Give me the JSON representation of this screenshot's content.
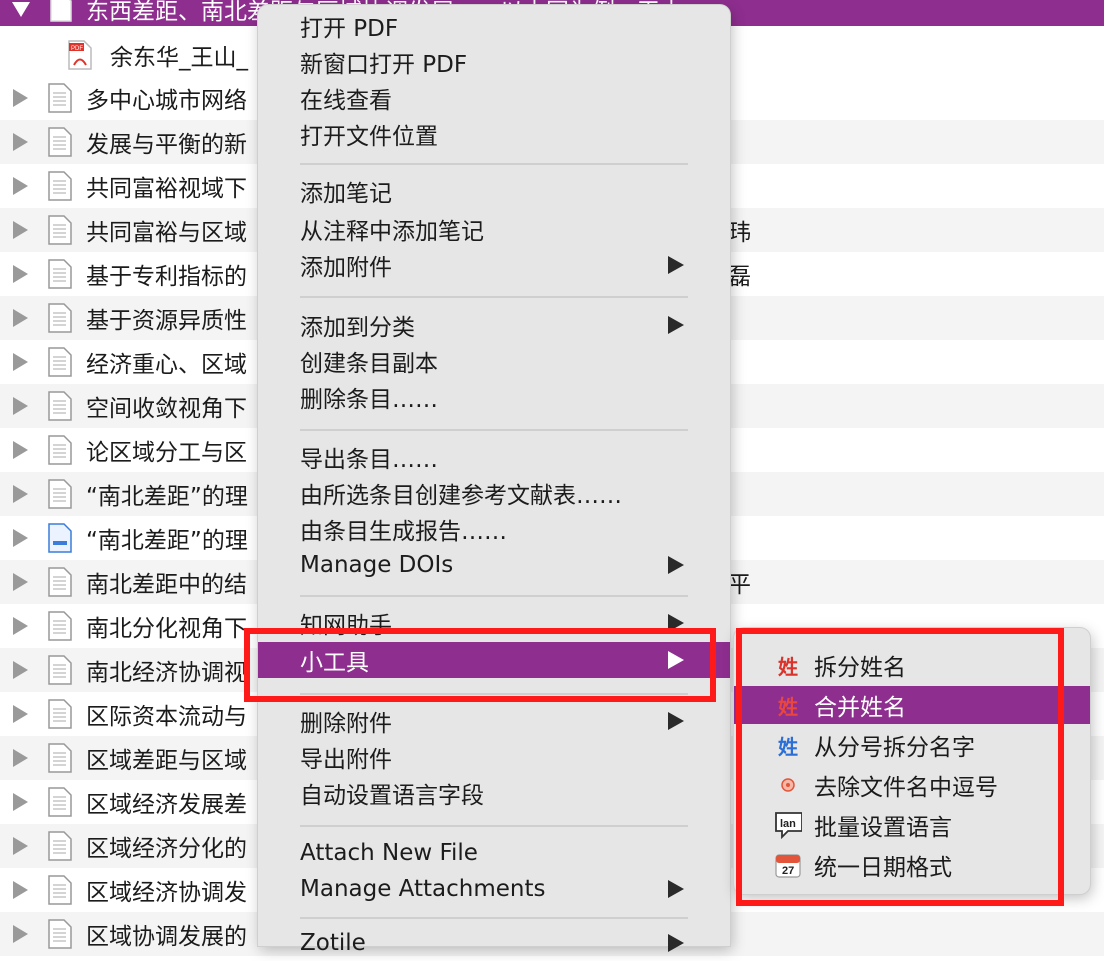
{
  "list": {
    "selected_title": "东西差距、南北差距与区域协调发展——以中国为例 · 王山",
    "child_attachment": "余东华_王山_",
    "rows": [
      {
        "title": "多中心城市网络"
      },
      {
        "title": "发展与平衡的新"
      },
      {
        "title": "共同富裕视域下"
      },
      {
        "title": "共同富裕与区域",
        "extra": "玮"
      },
      {
        "title": "基于专利指标的",
        "extra": "磊"
      },
      {
        "title": "基于资源异质性"
      },
      {
        "title": "经济重心、区域"
      },
      {
        "title": "空间收敛视角下"
      },
      {
        "title": "论区域分工与区"
      },
      {
        "title": "“南北差距”的理"
      },
      {
        "title": "“南北差距”的理"
      },
      {
        "title": "南北差距中的结",
        "extra": "平"
      },
      {
        "title": "南北分化视角下"
      },
      {
        "title": "南北经济协调视"
      },
      {
        "title": "区际资本流动与"
      },
      {
        "title": "区域差距与区域"
      },
      {
        "title": "区域经济发展差"
      },
      {
        "title": "区域经济分化的"
      },
      {
        "title": "区域经济协调发"
      },
      {
        "title": "区域协调发展的"
      }
    ]
  },
  "menu": {
    "items": [
      {
        "label": "打开 PDF"
      },
      {
        "label": "新窗口打开 PDF"
      },
      {
        "label": "在线查看"
      },
      {
        "label": "打开文件位置"
      },
      {
        "label": "添加笔记"
      },
      {
        "label": "从注释中添加笔记"
      },
      {
        "label": "添加附件"
      },
      {
        "label": "添加到分类"
      },
      {
        "label": "创建条目副本"
      },
      {
        "label": "删除条目……"
      },
      {
        "label": "导出条目……"
      },
      {
        "label": "由所选条目创建参考文献表……"
      },
      {
        "label": "由条目生成报告……"
      },
      {
        "label": "Manage DOIs"
      },
      {
        "label": "知网助手"
      },
      {
        "label": "小工具"
      },
      {
        "label": "删除附件"
      },
      {
        "label": "导出附件"
      },
      {
        "label": "自动设置语言字段"
      },
      {
        "label": "Attach New File"
      },
      {
        "label": "Manage Attachments"
      },
      {
        "label": "Zotile"
      }
    ]
  },
  "submenu": {
    "items": [
      {
        "label": "拆分姓名",
        "icon": "name-split-icon"
      },
      {
        "label": "合并姓名",
        "icon": "name-merge-icon"
      },
      {
        "label": "从分号拆分名字",
        "icon": "name-semicolon-icon"
      },
      {
        "label": "去除文件名中逗号",
        "icon": "comma-remove-icon"
      },
      {
        "label": "批量设置语言",
        "icon": "language-icon"
      },
      {
        "label": "统一日期格式",
        "icon": "calendar-icon"
      }
    ],
    "calendar_day": "27",
    "lang_badge": "lan",
    "name_glyph": "姓"
  },
  "colors": {
    "selection": "#8e2e8f",
    "annotation_red": "#ff1a1a",
    "menu_bg": "#e6e6e6"
  }
}
